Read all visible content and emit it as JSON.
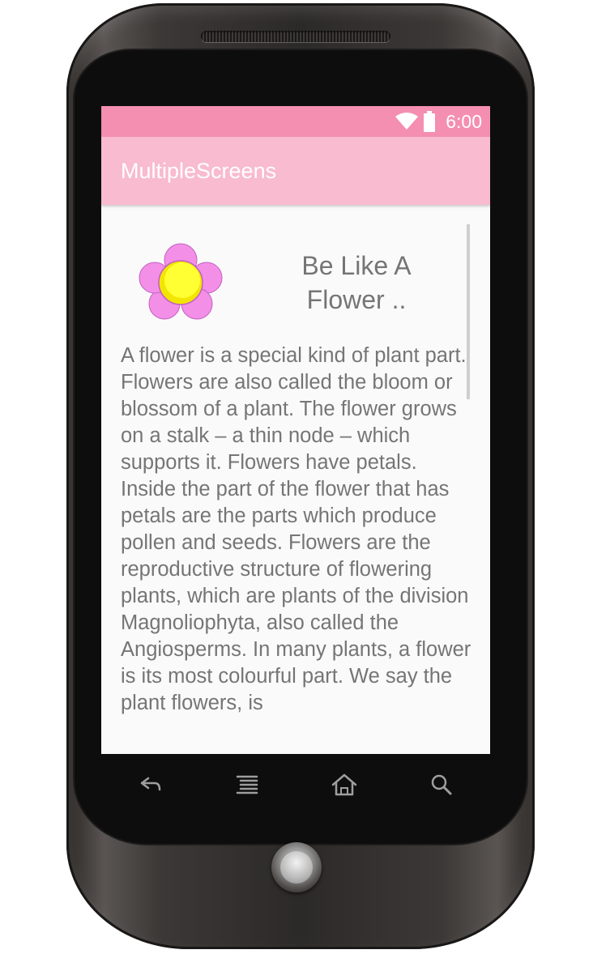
{
  "status_bar": {
    "time": "6:00",
    "icons": [
      "wifi-icon",
      "battery-icon"
    ],
    "color": "#f48fb1"
  },
  "app_bar": {
    "title": "MultipleScreens",
    "color": "#f8bbd0"
  },
  "content": {
    "image": "flower-icon",
    "heading": "Be Like A Flower ..",
    "body": "A flower is a special kind of plant part. Flowers are also called the bloom or blossom of a plant. The flower grows on a stalk – a thin node – which supports it. Flowers have petals. Inside the part of the flower that has petals are the parts which produce pollen and seeds. Flowers are the reproductive structure of flowering plants, which are plants of the division Magnoliophyta, also called the Angiosperms. In many plants, a flower is its most colourful part. We say the plant flowers, is"
  },
  "nav_bar": {
    "buttons": [
      "back-icon",
      "menu-icon",
      "home-icon",
      "search-icon"
    ]
  }
}
